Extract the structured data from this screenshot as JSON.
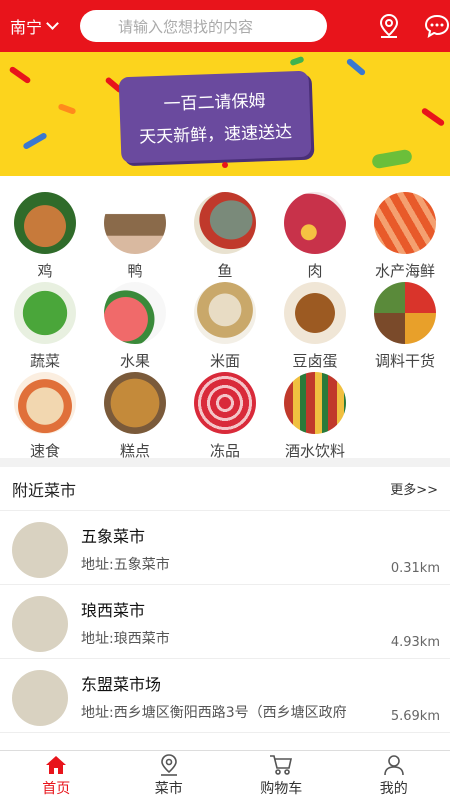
{
  "header": {
    "city": "南宁",
    "search_placeholder": "请输入您想找的内容",
    "brand_color": "#e8141b"
  },
  "banner": {
    "line1": "一百二请保姆",
    "line2": "天天新鲜，速速送达"
  },
  "categories": [
    {
      "label": "鸡",
      "icon": "chicken-icon"
    },
    {
      "label": "鸭",
      "icon": "duck-icon"
    },
    {
      "label": "鱼",
      "icon": "fish-icon"
    },
    {
      "label": "肉",
      "icon": "meat-icon"
    },
    {
      "label": "水产海鲜",
      "icon": "seafood-icon"
    },
    {
      "label": "蔬菜",
      "icon": "vegetable-icon"
    },
    {
      "label": "水果",
      "icon": "fruit-icon"
    },
    {
      "label": "米面",
      "icon": "rice-flour-icon"
    },
    {
      "label": "豆卤蛋",
      "icon": "tofu-egg-icon"
    },
    {
      "label": "调料干货",
      "icon": "spices-icon"
    },
    {
      "label": "速食",
      "icon": "fast-food-icon"
    },
    {
      "label": "糕点",
      "icon": "pastry-icon"
    },
    {
      "label": "冻品",
      "icon": "frozen-icon"
    },
    {
      "label": "酒水饮料",
      "icon": "drinks-icon"
    }
  ],
  "nearby": {
    "title": "附近菜市",
    "more": "更多>>",
    "markets": [
      {
        "name": "五象菜市",
        "address": "地址:五象菜市",
        "distance": "0.31km"
      },
      {
        "name": "琅西菜市",
        "address": "地址:琅西菜市",
        "distance": "4.93km"
      },
      {
        "name": "东盟菜市场",
        "address": "地址:西乡塘区衡阳西路3号（西乡塘区政府",
        "distance": "5.69km"
      }
    ]
  },
  "tabs": [
    {
      "label": "首页",
      "icon": "home-icon",
      "active": true
    },
    {
      "label": "菜市",
      "icon": "location-icon",
      "active": false
    },
    {
      "label": "购物车",
      "icon": "cart-icon",
      "active": false
    },
    {
      "label": "我的",
      "icon": "user-icon",
      "active": false
    }
  ]
}
